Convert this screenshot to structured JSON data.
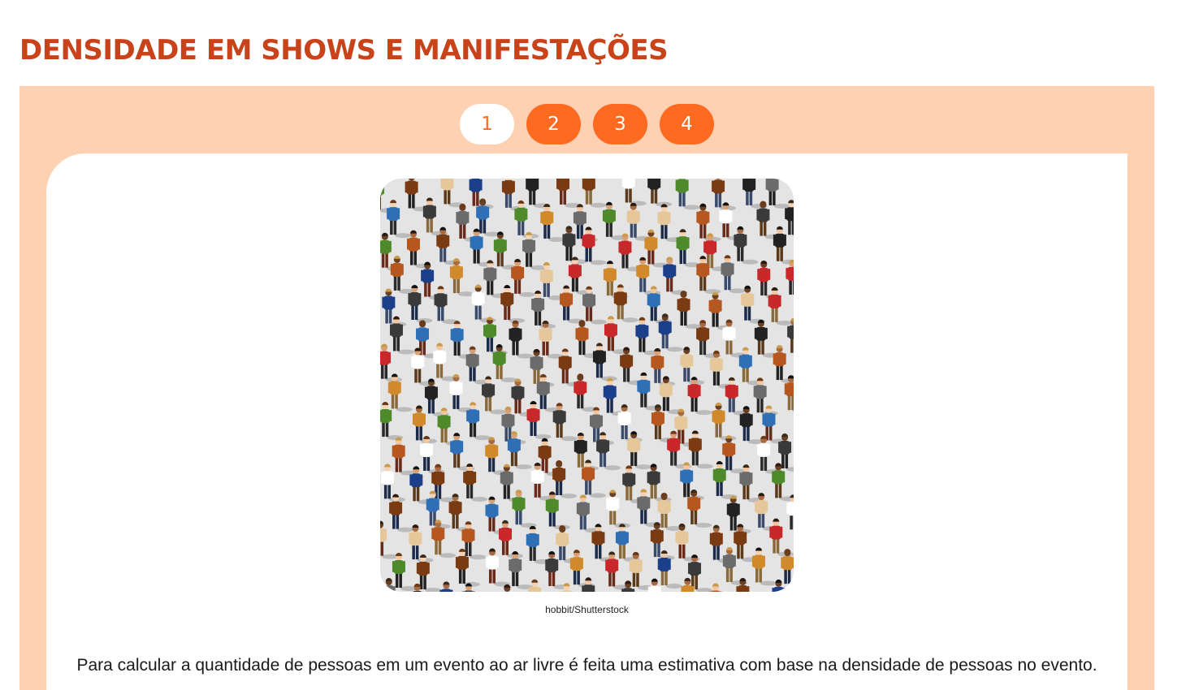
{
  "page": {
    "title": "DENSIDADE EM SHOWS E MANIFESTAÇÕES"
  },
  "pager": {
    "pages": [
      "1",
      "2",
      "3",
      "4"
    ],
    "active": 1
  },
  "content": {
    "image": {
      "alt": "crowd-of-people-illustration",
      "credit": "hobbit/Shutterstock"
    },
    "paragraph": "Para calcular a quantidade de pessoas em um evento ao ar livre é feita uma estimativa com base na densidade de pessoas no evento."
  },
  "colors": {
    "title": "#c9431a",
    "panel_bg": "#ffd1b3",
    "pager_button": "#ff6a21",
    "pager_active_bg": "#ffffff"
  }
}
